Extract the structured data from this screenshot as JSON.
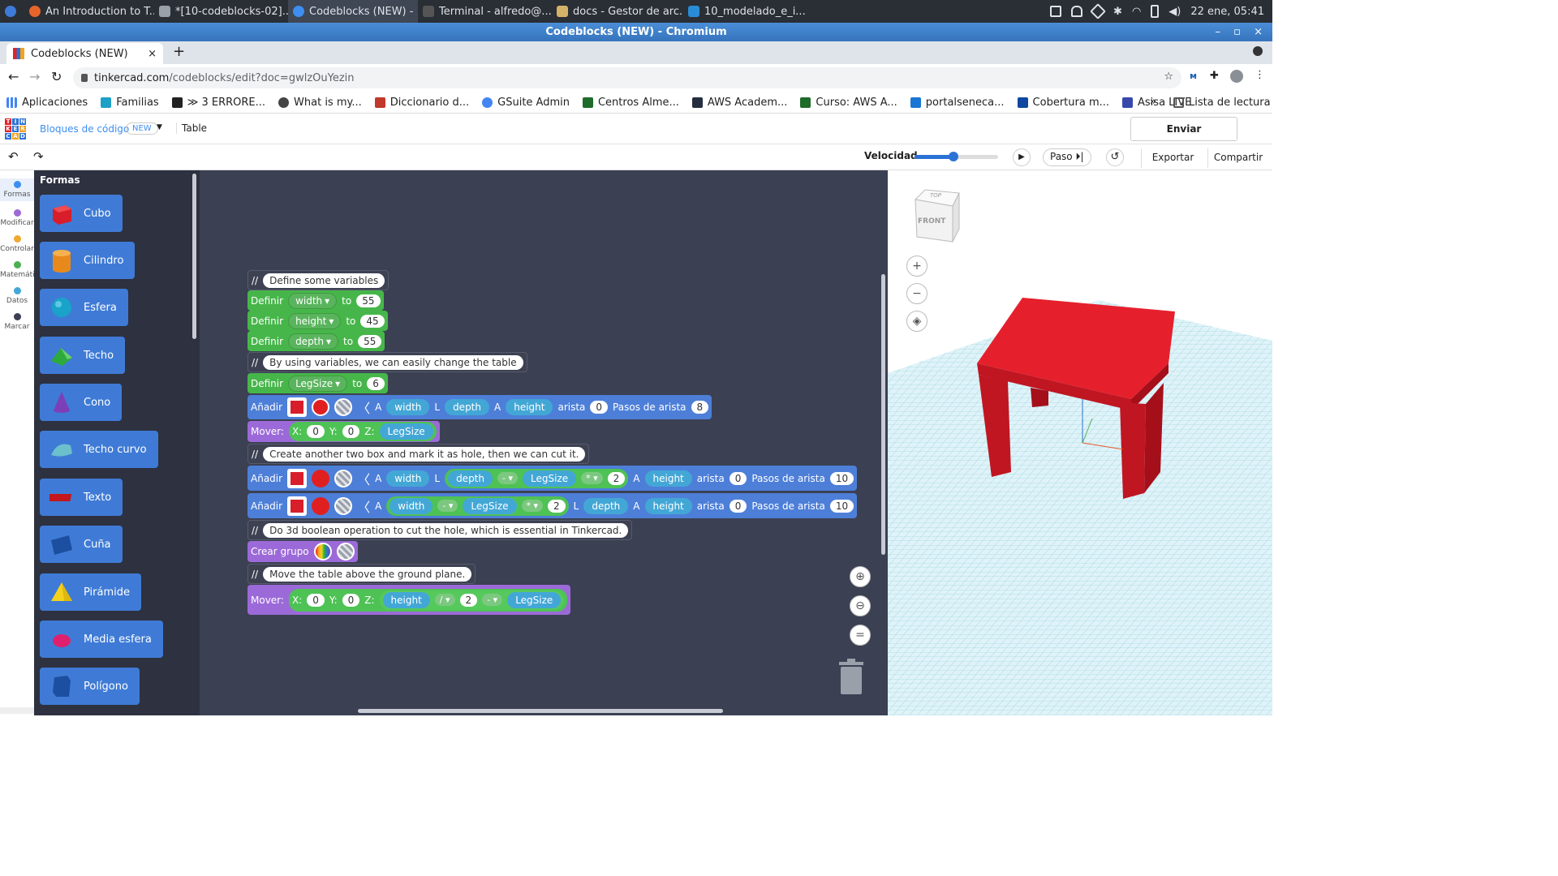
{
  "taskbar": {
    "apps": [
      {
        "label": "An Introduction to T...",
        "color": "#e6652b"
      },
      {
        "label": "*[10-codeblocks-02]...",
        "color": "#9aa0a8"
      },
      {
        "label": "Codeblocks (NEW) - ...",
        "color": "#3d8ef0"
      },
      {
        "label": "Terminal - alfredo@...",
        "color": "#555555"
      },
      {
        "label": "docs - Gestor de arc...",
        "color": "#d4b26a"
      },
      {
        "label": "10_modelado_e_i...",
        "color": "#2a8cd6"
      }
    ],
    "datetime": "22 ene, 05:41"
  },
  "window": {
    "title": "Codeblocks (NEW) - Chromium"
  },
  "browser": {
    "tab_title": "Codeblocks (NEW)",
    "url_domain": "tinkercad.com",
    "url_path": "/codeblocks/edit?doc=gwlzOuYezin",
    "bookmarks": [
      {
        "label": "Aplicaciones",
        "color": "#4285f4"
      },
      {
        "label": "Familias",
        "color": "#1ca0c8"
      },
      {
        "label": "≫ 3 ERRORE...",
        "color": "#222222"
      },
      {
        "label": "What is my...",
        "color": "#444444"
      },
      {
        "label": "Diccionario d...",
        "color": "#c0392b"
      },
      {
        "label": "GSuite Admin",
        "color": "#4285f4"
      },
      {
        "label": "Centros Alme...",
        "color": "#1e6b2a"
      },
      {
        "label": "AWS Academ...",
        "color": "#232f3e"
      },
      {
        "label": "Curso: AWS A...",
        "color": "#1e6b2a"
      },
      {
        "label": "portalseneca...",
        "color": "#1976d2"
      },
      {
        "label": "Cobertura m...",
        "color": "#0d47a1"
      },
      {
        "label": "Asisa LIVE",
        "color": "#3949ab"
      }
    ],
    "reading_list": "Lista de lectura"
  },
  "app": {
    "logo_letters": [
      "T",
      "I",
      "N",
      "K",
      "E",
      "R",
      "C",
      "A",
      "D"
    ],
    "breadcrumb": "Bloques de código",
    "badge": "NEW",
    "doc_name": "Table",
    "feedback_button": "Enviar comentarios",
    "speed_label": "Velocidad",
    "speed_fraction": 0.47,
    "step_label": "Paso",
    "export_label": "Exportar",
    "share_label": "Compartir"
  },
  "leftnav": [
    {
      "label": "Formas",
      "color": "#3d8ef0"
    },
    {
      "label": "Modificar",
      "color": "#9c6ad8"
    },
    {
      "label": "Controlar",
      "color": "#f0a830"
    },
    {
      "label": "Matemáti",
      "color": "#4caf50"
    },
    {
      "label": "Datos",
      "color": "#43a7d6"
    },
    {
      "label": "Marcar",
      "color": "#3b4053"
    }
  ],
  "palette": {
    "title": "Formas",
    "items": [
      {
        "label": "Cubo",
        "shape": "cube-icon",
        "color": "#d81e2a"
      },
      {
        "label": "Cilindro",
        "shape": "cylinder-icon",
        "color": "#e8891c"
      },
      {
        "label": "Esfera",
        "shape": "sphere-icon",
        "color": "#1aa3c8"
      },
      {
        "label": "Techo",
        "shape": "roof-icon",
        "color": "#2eaa3c"
      },
      {
        "label": "Cono",
        "shape": "cone-icon",
        "color": "#7c3fb8"
      },
      {
        "label": "Techo curvo",
        "shape": "curved-roof-icon",
        "color": "#6cc0cc"
      },
      {
        "label": "Texto",
        "shape": "text-icon",
        "color": "#c4161c"
      },
      {
        "label": "Cuña",
        "shape": "wedge-icon",
        "color": "#1d4fa0"
      },
      {
        "label": "Pirámide",
        "shape": "pyramid-icon",
        "color": "#f4d21c"
      },
      {
        "label": "Media esfera",
        "shape": "half-sphere-icon",
        "color": "#e0206e"
      },
      {
        "label": "Polígono",
        "shape": "polygon-icon",
        "color": "#1d4fa0"
      }
    ]
  },
  "code": {
    "comment_marker": "//",
    "c1": "Define some variables",
    "def_label": "Definir",
    "to_label": "to",
    "v1": {
      "name": "width",
      "value": "55"
    },
    "v2": {
      "name": "height",
      "value": "45"
    },
    "v3": {
      "name": "depth",
      "value": "55"
    },
    "c2": "By using variables, we can easily change the table",
    "v4": {
      "name": "LegSize",
      "value": "6"
    },
    "add_label": "Añadir",
    "move_label": "Mover:",
    "A": "A",
    "L": "L",
    "arista": "arista",
    "pasos": "Pasos de arista",
    "x": "X:",
    "y": "Y:",
    "z": "Z:",
    "zero": "0",
    "add1": {
      "w": "width",
      "d": "depth",
      "h": "height",
      "edge": "0",
      "steps": "8"
    },
    "move1": {
      "z": "LegSize"
    },
    "c3": "Create another two box and mark it as hole, then we can cut it.",
    "add2": {
      "w": "width",
      "d": "depth",
      "op1": "-",
      "leg": "LegSize",
      "op2": "*",
      "two": "2",
      "h": "height",
      "edge": "0",
      "steps": "10"
    },
    "add3": {
      "w": "width",
      "op1": "-",
      "leg": "LegSize",
      "op2": "*",
      "two": "2",
      "d": "depth",
      "h": "height",
      "edge": "0",
      "steps": "10"
    },
    "c4": "Do 3d boolean operation to cut the hole, which is essential in Tinkercad.",
    "group_label": "Crear grupo",
    "c5": "Move the table above the ground plane.",
    "move2": {
      "h": "height",
      "op1": "/",
      "two": "2",
      "op2": "-",
      "leg": "LegSize"
    }
  },
  "viewcube": {
    "top": "TOP",
    "front": "FRONT"
  }
}
